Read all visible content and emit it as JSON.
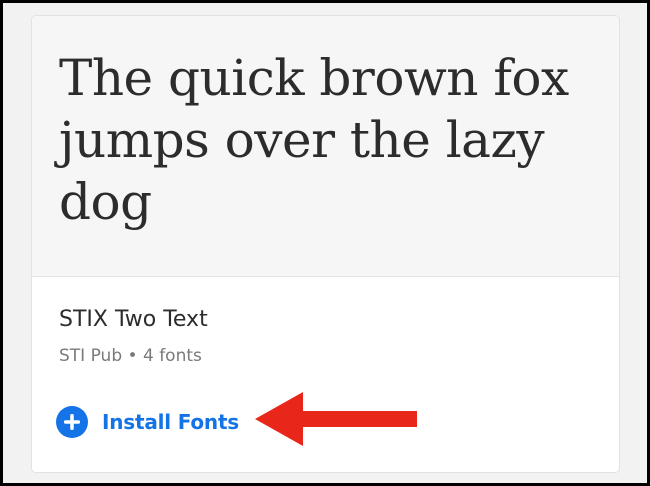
{
  "preview": {
    "sample_text": "The quick brown fox jumps over the lazy dog"
  },
  "font": {
    "name": "STIX Two Text",
    "foundry": "STI Pub",
    "separator": "•",
    "count": "4 fonts"
  },
  "install": {
    "label": "Install Fonts",
    "icon": "plus-circle-icon"
  },
  "annotation": {
    "icon": "red-arrow-left-icon"
  },
  "colors": {
    "accent": "#1473e6",
    "arrow": "#e8261a",
    "preview_background": "#f6f6f6",
    "text_primary": "#2c2c2c",
    "text_secondary": "#7a7a7a"
  }
}
